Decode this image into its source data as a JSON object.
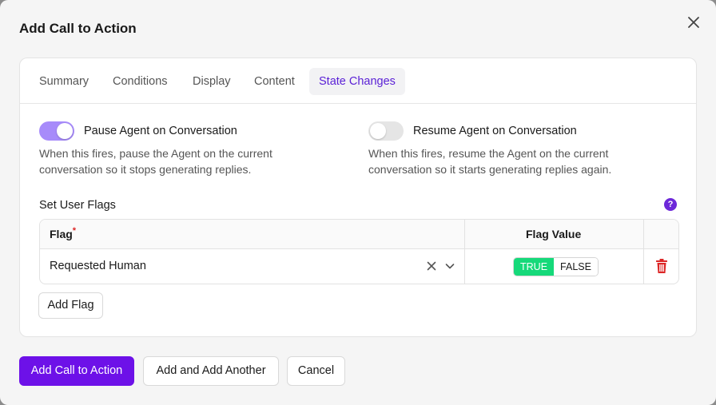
{
  "modal": {
    "title": "Add Call to Action",
    "close_icon": "close-icon"
  },
  "tabs": [
    {
      "label": "Summary",
      "active": false
    },
    {
      "label": "Conditions",
      "active": false
    },
    {
      "label": "Display",
      "active": false
    },
    {
      "label": "Content",
      "active": false
    },
    {
      "label": "State Changes",
      "active": true
    }
  ],
  "state_changes": {
    "pause": {
      "label": "Pause Agent on Conversation",
      "enabled": true,
      "description": "When this fires, pause the Agent on the current conversation so it stops generating replies."
    },
    "resume": {
      "label": "Resume Agent on Conversation",
      "enabled": false,
      "description": "When this fires, resume the Agent on the current conversation so it starts generating replies again."
    },
    "user_flags": {
      "label": "Set User Flags",
      "help_icon": "?",
      "columns": {
        "flag": "Flag",
        "required_marker": "*",
        "value": "Flag Value"
      },
      "rows": [
        {
          "flag": "Requested Human",
          "true_label": "TRUE",
          "false_label": "FALSE",
          "value": true
        }
      ],
      "add_label": "Add Flag"
    }
  },
  "footer": {
    "primary_label": "Add Call to Action",
    "secondary_label": "Add and Add Another",
    "cancel_label": "Cancel"
  },
  "colors": {
    "accent": "#6d11e8",
    "active_tab_text": "#5b21d6",
    "toggle_on": "#a78bfa",
    "true_green": "#16d97a",
    "delete_red": "#dc2626"
  }
}
